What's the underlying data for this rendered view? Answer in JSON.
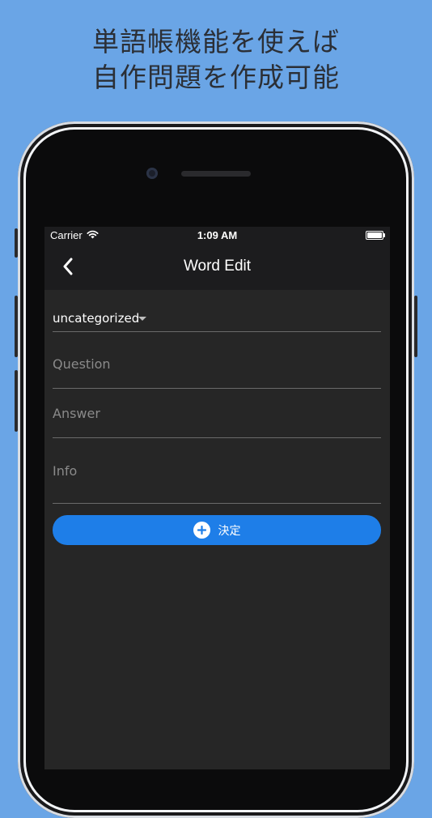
{
  "promo": {
    "line1": "単語帳機能を使えば",
    "line2": "自作問題を作成可能"
  },
  "status_bar": {
    "carrier": "Carrier",
    "time": "1:09 AM"
  },
  "nav": {
    "title": "Word Edit"
  },
  "form": {
    "category_value": "uncategorized",
    "question_placeholder": "Question",
    "answer_placeholder": "Answer",
    "info_placeholder": "Info",
    "submit_label": "決定"
  },
  "icons": {
    "back": "chevron-left-icon",
    "wifi": "wifi-icon",
    "battery": "battery-icon",
    "dropdown": "triangle-down-icon",
    "submit": "plus-circle-icon"
  },
  "colors": {
    "background": "#6aa5e6",
    "screen": "#262626",
    "navbar": "#1c1c1e",
    "accent": "#1e7ee8"
  }
}
